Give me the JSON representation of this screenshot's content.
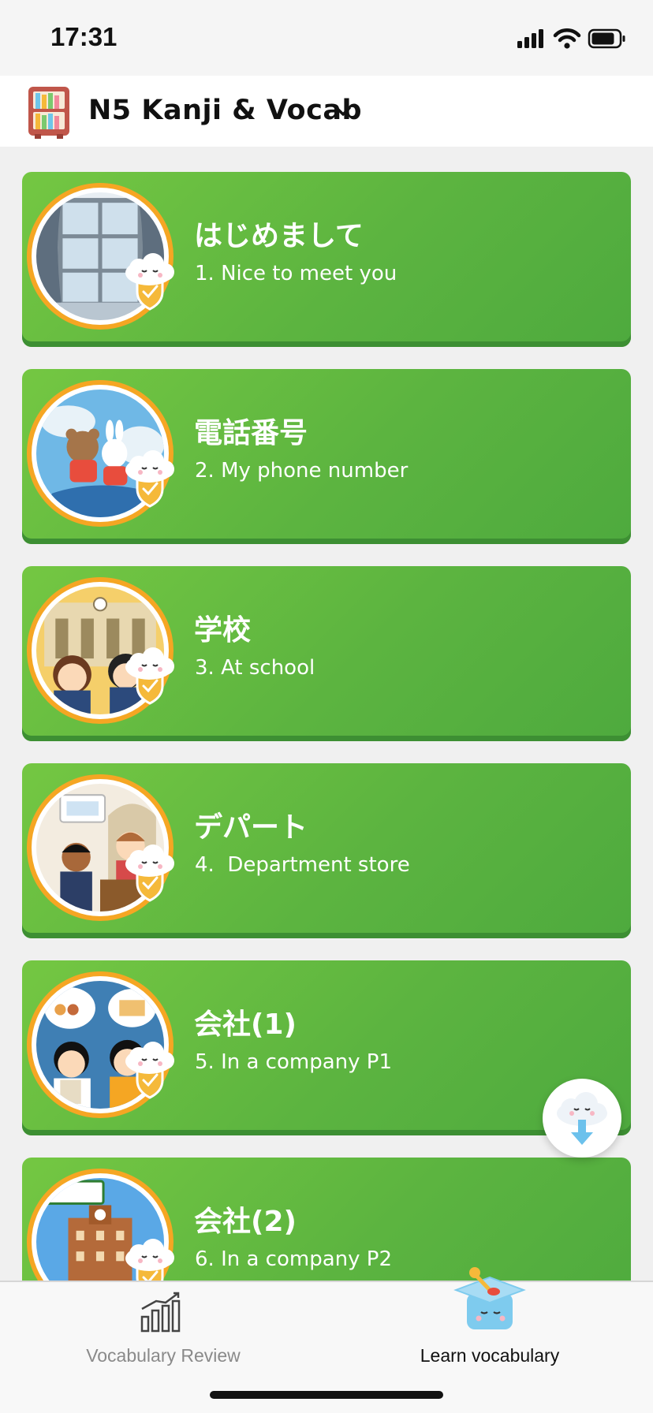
{
  "status_bar": {
    "time": "17:31"
  },
  "header": {
    "title": "N5 Kanji & Vocab"
  },
  "lessons": [
    {
      "title_jp": "はじめまして",
      "title_en": "1. Nice to meet you"
    },
    {
      "title_jp": "電話番号",
      "title_en": "2. My phone number"
    },
    {
      "title_jp": "学校",
      "title_en": "3. At school"
    },
    {
      "title_jp": "デパート",
      "title_en": "4.  Department store"
    },
    {
      "title_jp": "会社(1)",
      "title_en": "5. In a company P1"
    },
    {
      "title_jp": "会社(2)",
      "title_en": "6. In a company P2"
    }
  ],
  "tabs": {
    "review_label": "Vocabulary Review",
    "learn_label": "Learn vocabulary",
    "active": "learn"
  },
  "colors": {
    "card_green": "#5cb440",
    "thumb_ring": "#f5a623",
    "badge_gold": "#f5b93a"
  },
  "icons": {
    "card_badge": "cloud-shield-icon",
    "scroll_button": "cloud-arrow-down-icon",
    "review_tab": "bar-chart-icon",
    "learn_tab": "graduation-cap-icon"
  }
}
